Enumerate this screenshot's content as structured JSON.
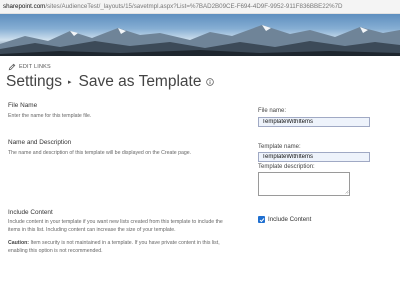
{
  "browser": {
    "url_host": "sharepoint.com",
    "url_path": "/sites/AudienceTest/_layouts/15/savetmpl.aspx?List=%7BAD2B09CE-F694-4D9F-9952-911F836BBE22%7D"
  },
  "header": {
    "edit_links_label": "EDIT LINKS",
    "breadcrumb_root": "Settings",
    "breadcrumb_separator": "▸",
    "page_title": "Save as Template"
  },
  "sections": {
    "file_name": {
      "title": "File Name",
      "description": "Enter the name for this template file."
    },
    "name_description": {
      "title": "Name and Description",
      "description": "The name and description of this template will be displayed on the Create page."
    },
    "include_content": {
      "title": "Include Content",
      "description": "Include content in your template if you want new lists created from this template to include the items in this list. Including content can increase the size of your template.",
      "caution_label": "Caution:",
      "caution_text": " Item security is not maintained in a template. If you have private content in this list, enabling this option is not recommended."
    }
  },
  "form": {
    "file_name_label": "File name:",
    "file_name_value": "TemplateWithItems",
    "template_name_label": "Template name:",
    "template_name_value": "TemplateWithItems",
    "template_description_label": "Template description:",
    "template_description_value": "",
    "include_content_label": "Include Content",
    "include_content_checked": true
  },
  "colors": {
    "accent": "#1f6fd0",
    "input_fill": "#eef3fb",
    "input_border": "#a0a9c4"
  },
  "icons": {
    "edit": "pencil-icon",
    "info": "info-icon",
    "breadcrumb": "triangle-right-icon",
    "check": "checkmark-icon"
  }
}
